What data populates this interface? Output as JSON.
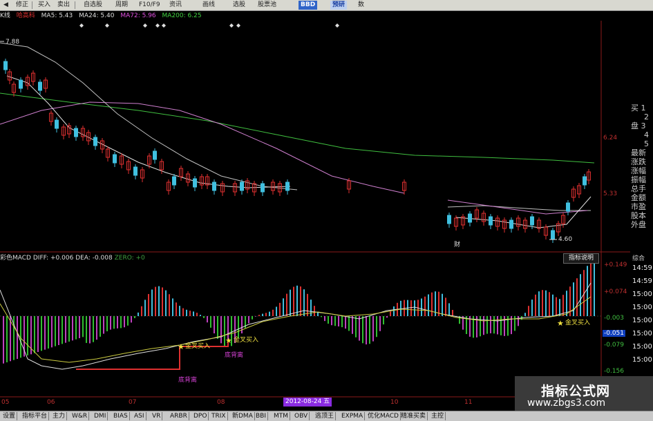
{
  "toolbar": {
    "items": [
      "修正",
      "买入",
      "卖出",
      "自选股",
      "周期",
      "F10/F9",
      "资讯",
      "画线",
      "选股",
      "股票池",
      "BBD",
      "预研",
      "数"
    ],
    "brand_color": "#2f64c8"
  },
  "info_line": {
    "chart_label": "K线",
    "stock_name": "哈高科",
    "ma5": "MA5: 5.43",
    "ma24": "MA24: 5.40",
    "ma72": "MA72: 5.96",
    "ma200": "MA200: 6.25"
  },
  "price_labels": {
    "high_marker": "7.88",
    "low_marker": "4.60",
    "axis_top": "6.24",
    "axis_mid": "5.33",
    "cai": "财"
  },
  "side_panel": {
    "items": [
      "买 1",
      "2",
      "盘 3",
      "4",
      "5",
      "最新",
      "涨跌",
      "涨幅",
      "振幅",
      "总手",
      "金额",
      "市盈",
      "股本",
      "外盘"
    ],
    "sub_title": "综合",
    "times": [
      "14:59",
      "14:59",
      "15:00",
      "15:00",
      "15:00",
      "15:00",
      "15:00",
      "15:00"
    ]
  },
  "macd": {
    "title": "彩色MACD",
    "diff": "DIFF: +0.006",
    "dea": "DEA: -0.008",
    "zero": "ZERO: +0",
    "indicator_button": "指标说明",
    "axis": [
      "+0.149",
      "+0.074",
      "-0.003",
      "-0.051",
      "-0.079",
      "-0.156"
    ],
    "annotations": [
      "金叉买入",
      "金叉买入",
      "金叉买入",
      "底背离",
      "底背离"
    ],
    "colors": {
      "up": "#e03030",
      "down": "#30c030",
      "cyan": "#40c0e0",
      "magenta": "#c040c0"
    }
  },
  "time_axis": [
    "05",
    "06",
    "07",
    "08",
    "10",
    "11"
  ],
  "date_badge": "2012-08-24 五",
  "bottom_tabs": [
    "设置",
    "指标平台",
    "主力",
    "W&R",
    "DMI",
    "BIAS",
    "ASI",
    "VR",
    "ARBR",
    "DPO",
    "TRIX",
    "新DMA",
    "BBI",
    "MTM",
    "OBV",
    "逃顶王",
    "EXPMA",
    "优化MACD",
    "精准买卖",
    "主控"
  ],
  "watermark": {
    "title": "指标公式网",
    "url": "www.zbgs3.com"
  }
}
